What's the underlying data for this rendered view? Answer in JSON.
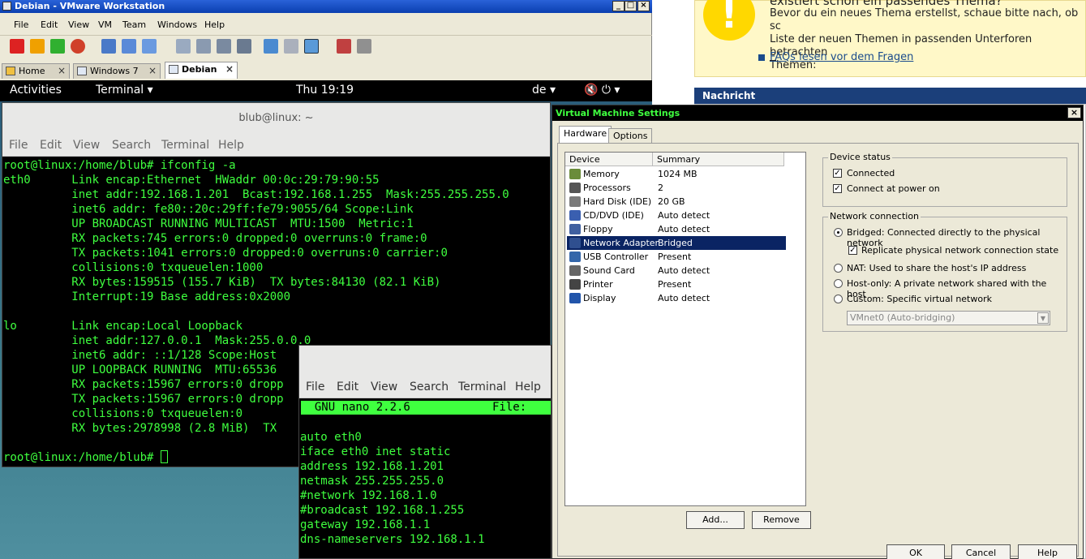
{
  "vmware": {
    "title": "Debian - VMware Workstation",
    "menu": [
      "File",
      "Edit",
      "View",
      "VM",
      "Team",
      "Windows",
      "Help"
    ],
    "tabs": [
      "Home",
      "Windows 7",
      "Debian"
    ]
  },
  "gnome": {
    "activities": "Activities",
    "app": "Terminal ▾",
    "clock": "Thu 19:19",
    "lang": "de ▾",
    "systray": "🔇 ⏻ ▾"
  },
  "term1": {
    "title": "blub@linux: ~",
    "menu": [
      "File",
      "Edit",
      "View",
      "Search",
      "Terminal",
      "Help"
    ],
    "lines": [
      "root@linux:/home/blub# ifconfig -a",
      "eth0      Link encap:Ethernet  HWaddr 00:0c:29:79:90:55",
      "          inet addr:192.168.1.201  Bcast:192.168.1.255  Mask:255.255.255.0",
      "          inet6 addr: fe80::20c:29ff:fe79:9055/64 Scope:Link",
      "          UP BROADCAST RUNNING MULTICAST  MTU:1500  Metric:1",
      "          RX packets:745 errors:0 dropped:0 overruns:0 frame:0",
      "          TX packets:1041 errors:0 dropped:0 overruns:0 carrier:0",
      "          collisions:0 txqueuelen:1000",
      "          RX bytes:159515 (155.7 KiB)  TX bytes:84130 (82.1 KiB)",
      "          Interrupt:19 Base address:0x2000",
      "",
      "lo        Link encap:Local Loopback",
      "          inet addr:127.0.0.1  Mask:255.0.0.0",
      "          inet6 addr: ::1/128 Scope:Host",
      "          UP LOOPBACK RUNNING  MTU:65536",
      "          RX packets:15967 errors:0 dropp",
      "          TX packets:15967 errors:0 dropp",
      "          collisions:0 txqueuelen:0",
      "          RX bytes:2978998 (2.8 MiB)  TX",
      "",
      "root@linux:/home/blub# "
    ]
  },
  "term2": {
    "menu": [
      "File",
      "Edit",
      "View",
      "Search",
      "Terminal",
      "Help"
    ],
    "nano_bar": "  GNU nano 2.2.6            File:",
    "lines": [
      "auto eth0",
      "iface eth0 inet static",
      "address 192.168.1.201",
      "netmask 255.255.255.0",
      "#network 192.168.1.0",
      "#broadcast 192.168.1.255",
      "gateway 192.168.1.1",
      "dns-nameservers 192.168.1.1"
    ]
  },
  "forum": {
    "notice": "existiert schon ein passendes Thema? Bevor du ein neues Thema erstellst, schaue bitte nach, ob sc Liste der neuen Themen in passenden Unterforen betrachten Themen:",
    "notice_line1": "existiert schon ein passendes Thema?",
    "notice_line2": "Bevor du ein neues Thema erstellst, schaue bitte nach, ob sc",
    "notice_line3": "Liste der neuen Themen in passenden Unterforen betrachten",
    "notice_line4": "Themen:",
    "faq_link": "FAQs lesen vor dem Fragen",
    "section": "Nachricht"
  },
  "dialog": {
    "title": "Virtual Machine Settings",
    "tabs": [
      "Hardware",
      "Options"
    ],
    "col_device": "Device",
    "col_summary": "Summary",
    "devices": [
      {
        "name": "Memory",
        "summary": "1024 MB",
        "icon": "memory-icon",
        "color": "#6a8c3a"
      },
      {
        "name": "Processors",
        "summary": "2",
        "icon": "processor-icon",
        "color": "#555555"
      },
      {
        "name": "Hard Disk (IDE)",
        "summary": "20 GB",
        "icon": "hard-disk-icon",
        "color": "#7a7a7a"
      },
      {
        "name": "CD/DVD (IDE)",
        "summary": "Auto detect",
        "icon": "cd-icon",
        "color": "#3a5fb0"
      },
      {
        "name": "Floppy",
        "summary": "Auto detect",
        "icon": "floppy-icon",
        "color": "#4060a0"
      },
      {
        "name": "Network Adapter",
        "summary": "Bridged",
        "icon": "network-icon",
        "color": "#2f4f8f"
      },
      {
        "name": "USB Controller",
        "summary": "Present",
        "icon": "usb-icon",
        "color": "#3366aa"
      },
      {
        "name": "Sound Card",
        "summary": "Auto detect",
        "icon": "sound-icon",
        "color": "#666666"
      },
      {
        "name": "Printer",
        "summary": "Present",
        "icon": "printer-icon",
        "color": "#444444"
      },
      {
        "name": "Display",
        "summary": "Auto detect",
        "icon": "display-icon",
        "color": "#2255aa"
      }
    ],
    "add_button": "Add...",
    "remove_button": "Remove",
    "device_status": "Device status",
    "connected": "Connected",
    "connect_power": "Connect at power on",
    "network_connection": "Network connection",
    "opt_bridged": "Bridged: Connected directly to the physical network",
    "opt_replicate": "Replicate physical network connection state",
    "opt_nat": "NAT: Used to share the host's IP address",
    "opt_hostonly": "Host-only: A private network shared with the host",
    "opt_custom": "Custom: Specific virtual network",
    "vmnet_value": "VMnet0 (Auto-bridging)",
    "ok": "OK",
    "cancel": "Cancel",
    "help": "Help"
  }
}
